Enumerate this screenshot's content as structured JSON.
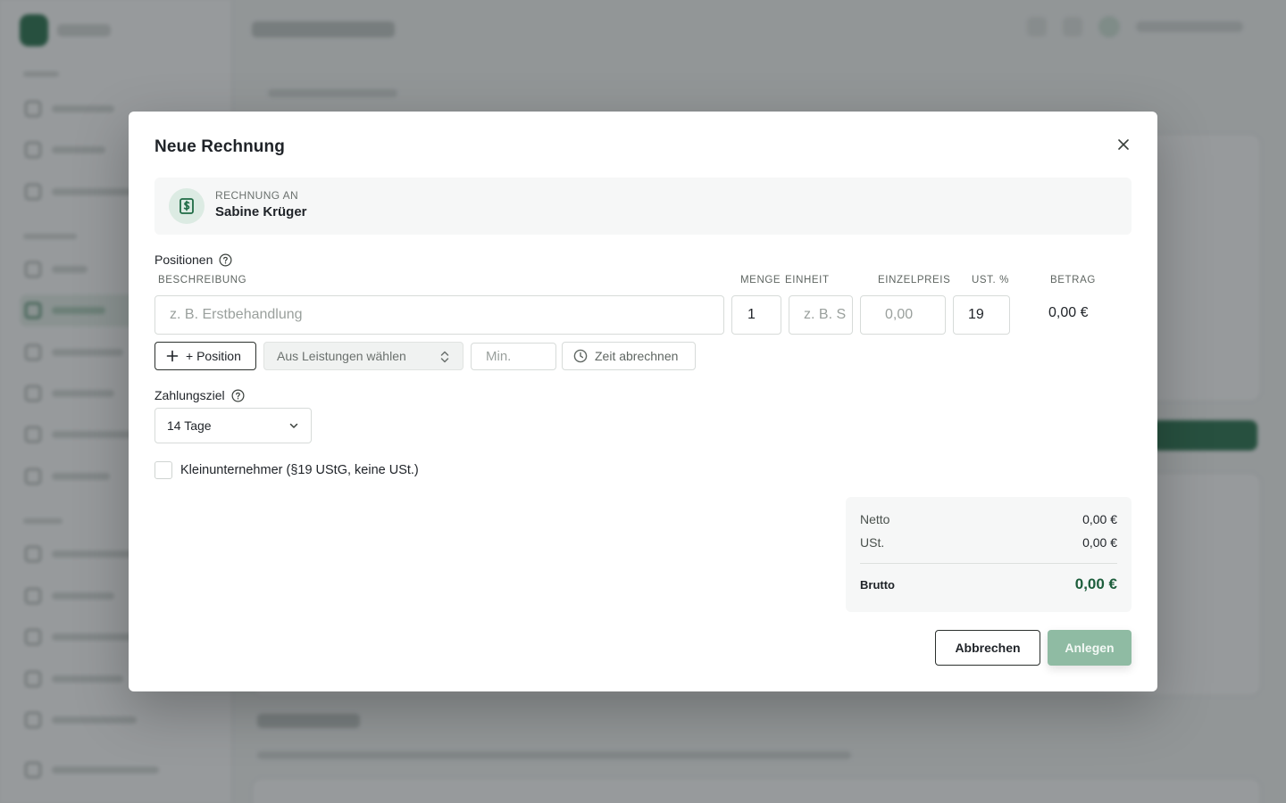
{
  "modal": {
    "title": "Neue Rechnung",
    "recipient": {
      "label": "Rechnung an",
      "name": "Sabine Krüger"
    },
    "positions_label": "Positionen",
    "columns": {
      "description": "Beschreibung",
      "quantity": "Menge",
      "unit": "Einheit",
      "unit_price": "Einzelpreis",
      "vat": "USt. %",
      "amount": "Betrag"
    },
    "line_item": {
      "description_placeholder": "z. B. Erstbehandlung",
      "quantity": "1",
      "unit_placeholder": "z. B. S",
      "unit_price_placeholder": "0,00",
      "vat": "19",
      "amount": "0,00 €"
    },
    "add_position_label": "+ Position",
    "service_select_placeholder": "Aus Leistungen wählen",
    "minutes_placeholder": "Min.",
    "bill_time_label": "Zeit abrechnen",
    "payment_term_label": "Zahlungsziel",
    "payment_term_value": "14 Tage",
    "small_business_label": "Kleinunternehmer (§19 UStG, keine USt.)",
    "small_business_checked": false,
    "summary": {
      "net_label": "Netto",
      "net_value": "0,00 €",
      "vat_label": "USt.",
      "vat_value": "0,00 €",
      "gross_label": "Brutto",
      "gross_value": "0,00 €"
    },
    "cancel_label": "Abbrechen",
    "create_label": "Anlegen"
  },
  "colors": {
    "brand": "#1f6b45",
    "brand_light": "#dcebe3",
    "primary_disabled": "#8fbba3",
    "overlay": "rgba(48,54,58,0.5)"
  },
  "icons": {
    "close": "close-icon",
    "recipient": "invoice-dollar-icon",
    "help": "help-circle-icon",
    "plus": "plus-icon",
    "updown": "chevron-updown-icon",
    "clock": "clock-icon",
    "chevron": "chevron-down-icon"
  }
}
